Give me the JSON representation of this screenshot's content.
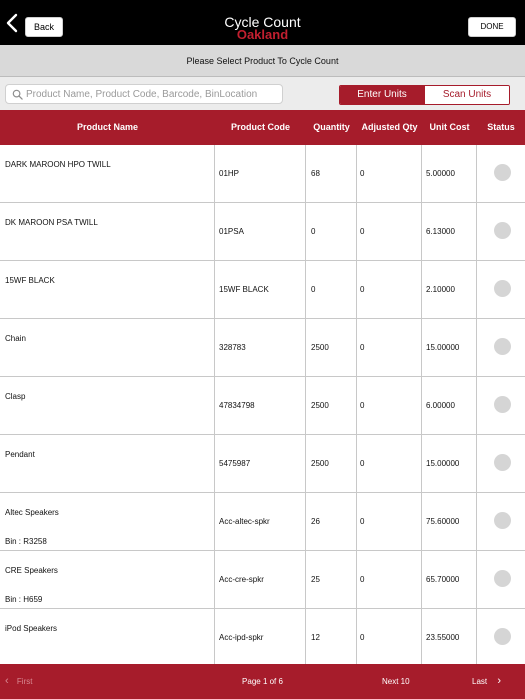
{
  "header": {
    "back_label": "Back",
    "title": "Cycle Count",
    "subtitle": "Oakland",
    "done_label": "DONE"
  },
  "instruction": "Please Select Product To Cycle Count",
  "search": {
    "placeholder": "Product Name, Product Code, Barcode, BinLocation",
    "value": ""
  },
  "segments": {
    "enter_units": "Enter Units",
    "scan_units": "Scan Units",
    "selected": "Enter Units"
  },
  "table": {
    "columns": [
      "Product Name",
      "Product Code",
      "Quantity",
      "Adjusted Qty",
      "Unit Cost",
      "Status"
    ],
    "rows": [
      {
        "name": "DARK MAROON HPO TWILL",
        "bin": "",
        "code": "01HP",
        "qty": "68",
        "adj": "0",
        "cost": "5.00000"
      },
      {
        "name": "DK MAROON PSA TWILL",
        "bin": "",
        "code": "01PSA",
        "qty": "0",
        "adj": "0",
        "cost": "6.13000"
      },
      {
        "name": "15WF BLACK",
        "bin": "",
        "code": "15WF BLACK",
        "qty": "0",
        "adj": "0",
        "cost": "2.10000"
      },
      {
        "name": "Chain",
        "bin": "",
        "code": "328783",
        "qty": "2500",
        "adj": "0",
        "cost": "15.00000"
      },
      {
        "name": "Clasp",
        "bin": "",
        "code": "47834798",
        "qty": "2500",
        "adj": "0",
        "cost": "6.00000"
      },
      {
        "name": "Pendant",
        "bin": "",
        "code": "5475987",
        "qty": "2500",
        "adj": "0",
        "cost": "15.00000"
      },
      {
        "name": "Altec Speakers",
        "bin": "Bin : R3258",
        "code": "Acc-altec-spkr",
        "qty": "26",
        "adj": "0",
        "cost": "75.60000"
      },
      {
        "name": "CRE Speakers",
        "bin": "Bin : H659",
        "code": "Acc-cre-spkr",
        "qty": "25",
        "adj": "0",
        "cost": "65.70000"
      },
      {
        "name": "iPod Speakers",
        "bin": "",
        "code": "Acc-ipd-spkr",
        "qty": "12",
        "adj": "0",
        "cost": "23.55000"
      }
    ]
  },
  "footer": {
    "first_label": "First",
    "page_label": "Page 1 of 6",
    "next_label": "Next 10",
    "last_label": "Last"
  },
  "colors": {
    "accent": "#a61c2b",
    "subtitle": "#c21f2f",
    "header_bg": "#000000",
    "status_dot": "#d5d5d5"
  }
}
